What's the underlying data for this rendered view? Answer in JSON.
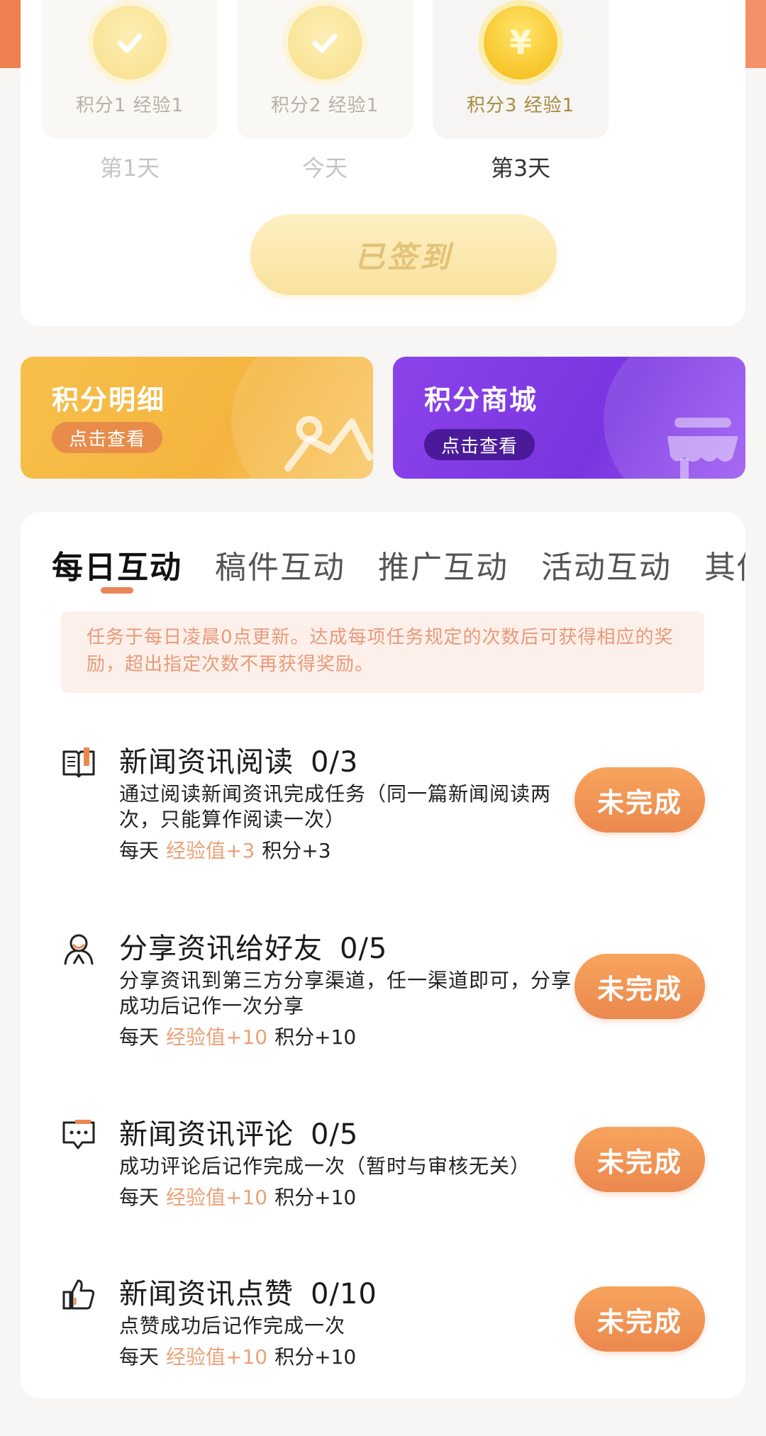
{
  "signin": {
    "days": [
      {
        "reward": "积分1  经验1",
        "label": "第1天"
      },
      {
        "reward": "积分2  经验1",
        "label": "今天"
      },
      {
        "reward": "积分3  经验1",
        "label": "第3天"
      }
    ],
    "coin_symbol": "¥",
    "button_label": "已签到"
  },
  "cards": {
    "points_detail": {
      "title": "积分明细",
      "action": "点击查看"
    },
    "points_mall": {
      "title": "积分商城",
      "action": "点击查看"
    }
  },
  "tabs": [
    "每日互动",
    "稿件互动",
    "推广互动",
    "活动互动",
    "其他"
  ],
  "active_tab_index": 0,
  "notice": "任务于每日凌晨0点更新。达成每项任务规定的次数后可获得相应的奖励，超出指定次数不再获得奖励。",
  "tasks": [
    {
      "icon": "book-icon",
      "title": "新闻资讯阅读",
      "count": "0/3",
      "desc": "通过阅读新闻资讯完成任务（同一篇新闻阅读两次，只能算作阅读一次）",
      "freq": "每天",
      "exp": "经验值+3",
      "points": "积分+3",
      "button": "未完成"
    },
    {
      "icon": "users-icon",
      "title": "分享资讯给好友",
      "count": "0/5",
      "desc": "分享资讯到第三方分享渠道，任一渠道即可，分享成功后记作一次分享",
      "freq": "每天",
      "exp": "经验值+10",
      "points": "积分+10",
      "button": "未完成"
    },
    {
      "icon": "comment-icon",
      "title": "新闻资讯评论",
      "count": "0/5",
      "desc": "成功评论后记作完成一次（暂时与审核无关）",
      "freq": "每天",
      "exp": "经验值+10",
      "points": "积分+10",
      "button": "未完成"
    },
    {
      "icon": "thumbs-up-icon",
      "title": "新闻资讯点赞",
      "count": "0/10",
      "desc": "点赞成功后记作完成一次",
      "freq": "每天",
      "exp": "经验值+10",
      "points": "积分+10",
      "button": "未完成"
    }
  ],
  "colors": {
    "accent": "#eb884e",
    "exp_text": "#eba178",
    "points_detail_bg": "#f6c04a",
    "points_mall_bg": "#7a35e0"
  }
}
